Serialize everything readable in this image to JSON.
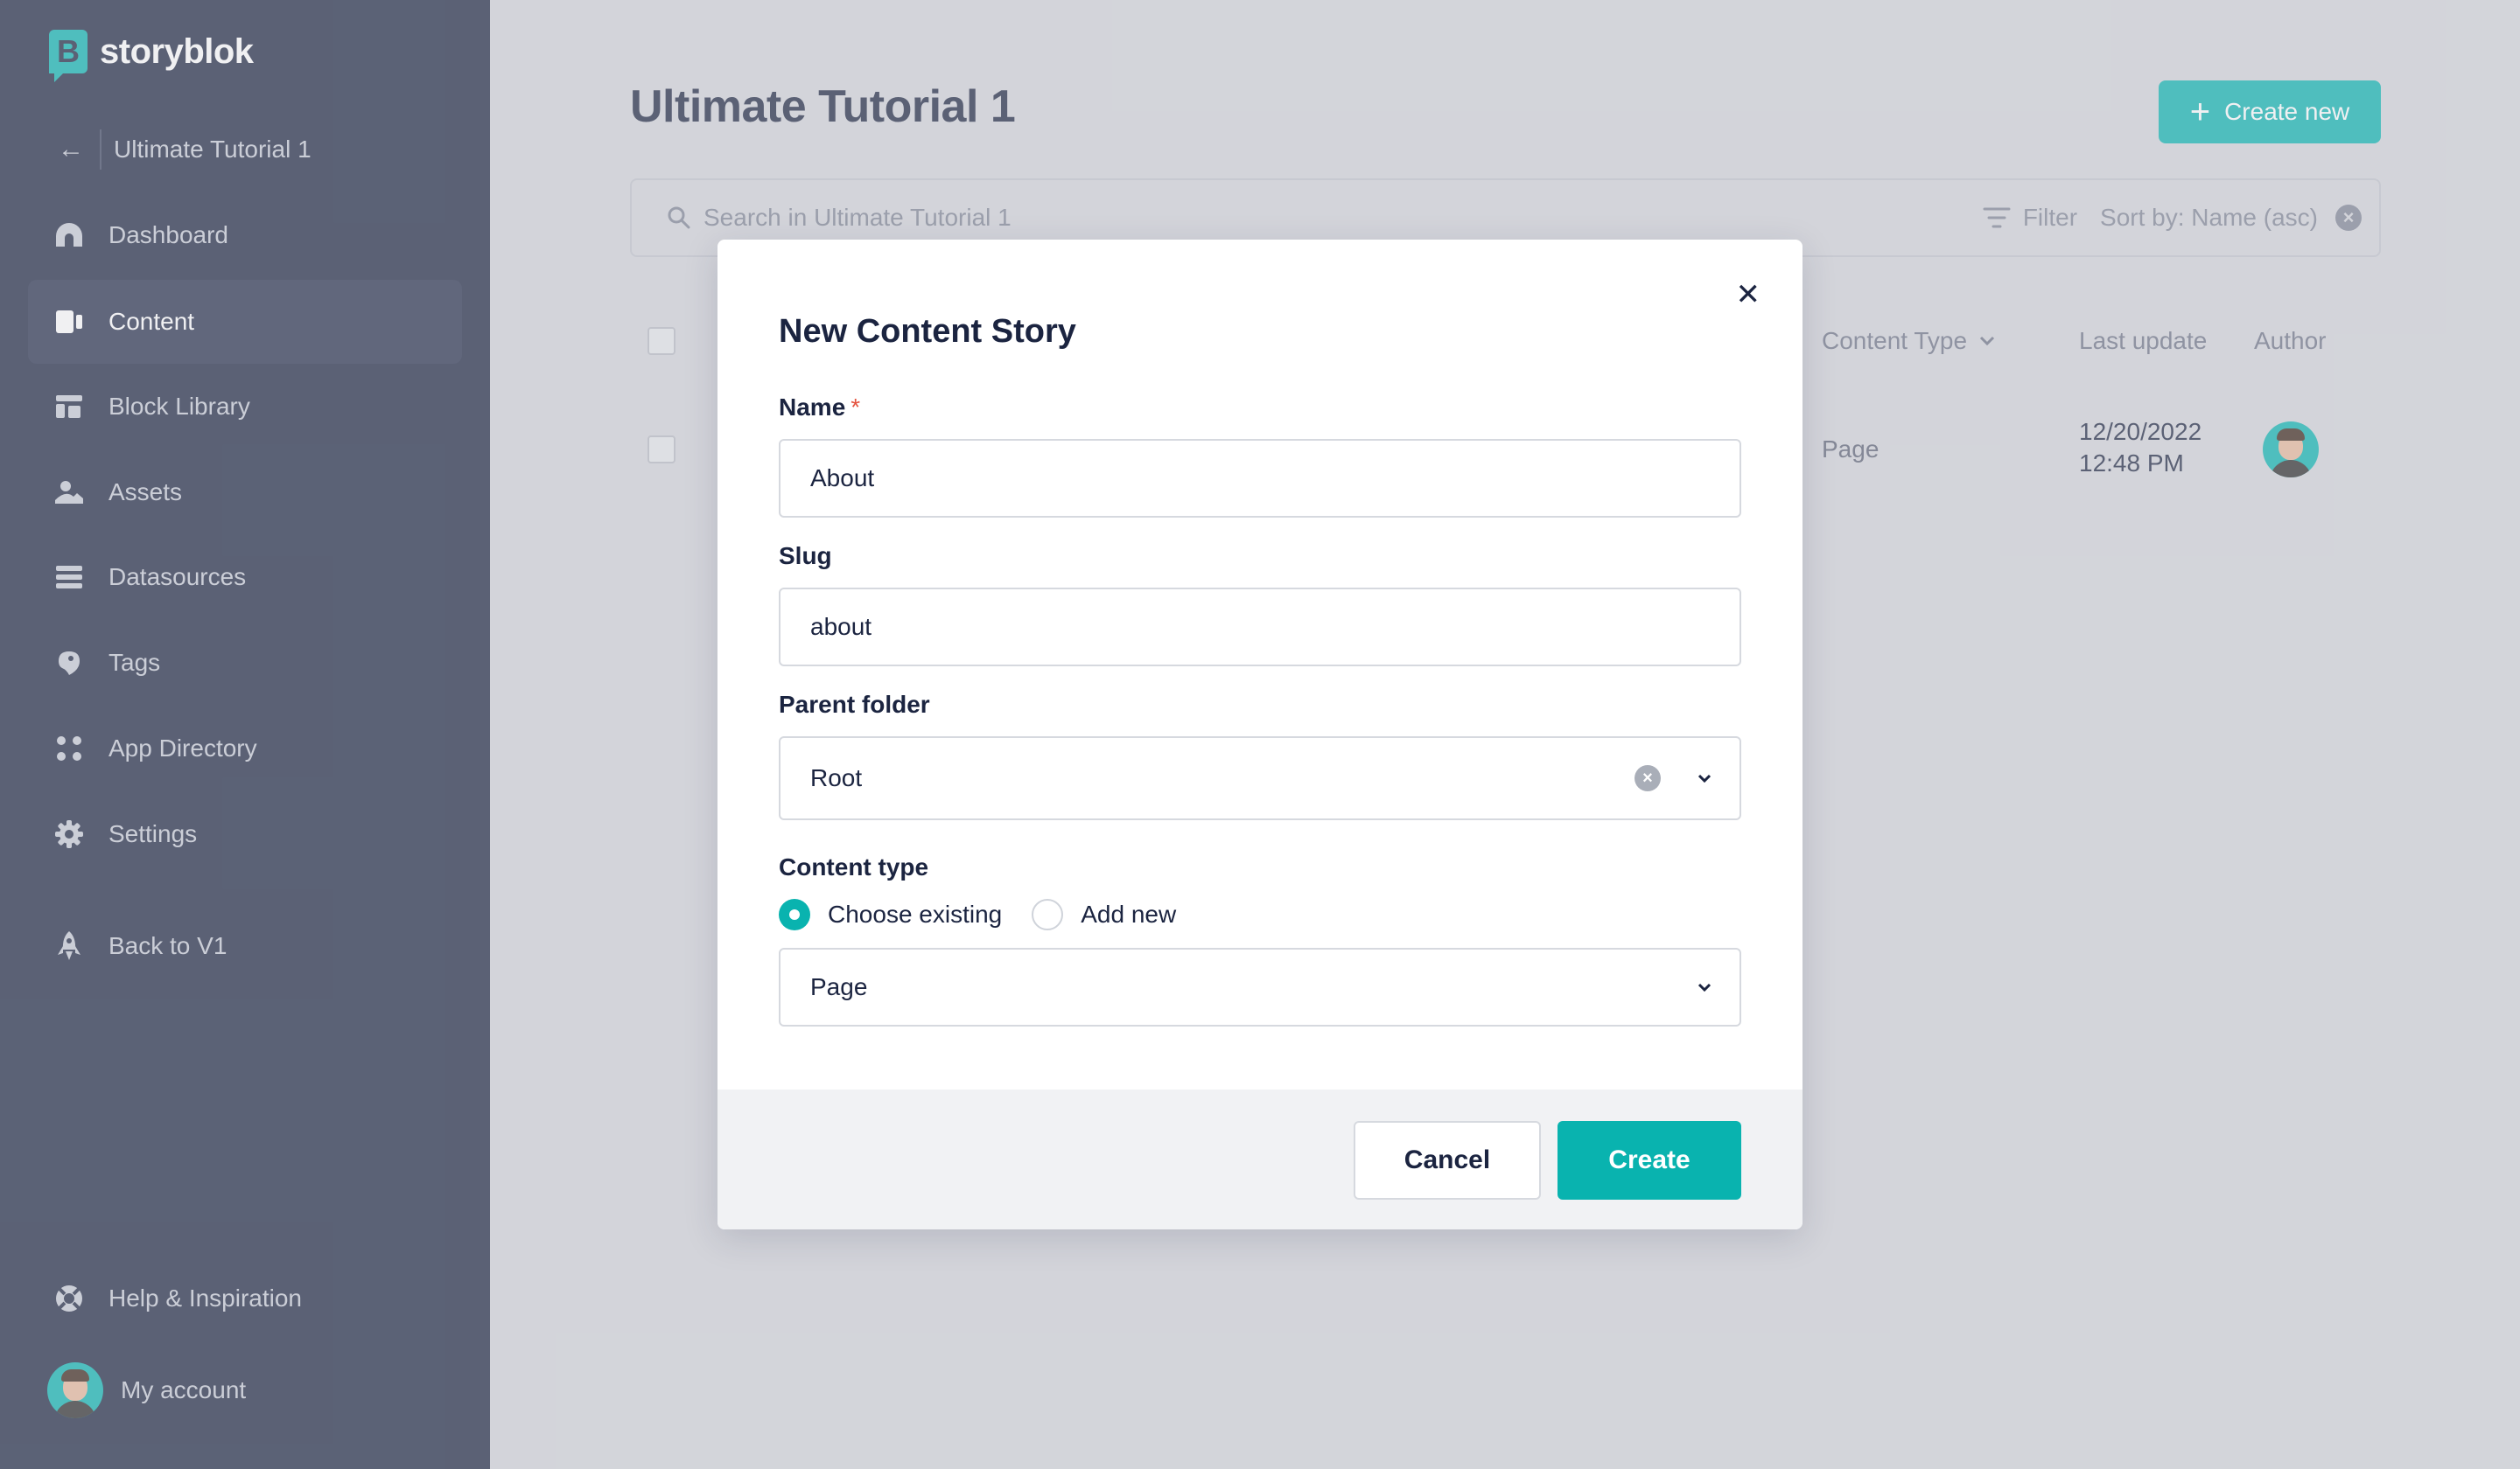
{
  "brand": {
    "name": "storyblok",
    "logo_letter": "B"
  },
  "sidebar": {
    "space_name": "Ultimate Tutorial 1",
    "items": [
      {
        "label": "Dashboard",
        "icon": "dashboard-icon"
      },
      {
        "label": "Content",
        "icon": "content-icon",
        "active": true
      },
      {
        "label": "Block Library",
        "icon": "block-library-icon"
      },
      {
        "label": "Assets",
        "icon": "assets-icon"
      },
      {
        "label": "Datasources",
        "icon": "datasources-icon"
      },
      {
        "label": "Tags",
        "icon": "tag-icon"
      },
      {
        "label": "App Directory",
        "icon": "app-directory-icon"
      },
      {
        "label": "Settings",
        "icon": "gear-icon"
      },
      {
        "label": "Back to V1",
        "icon": "rocket-icon"
      }
    ],
    "help_label": "Help & Inspiration",
    "account_label": "My account"
  },
  "main": {
    "title": "Ultimate Tutorial 1",
    "create_new_label": "Create new",
    "search": {
      "placeholder": "Search in Ultimate Tutorial 1"
    },
    "filter_label": "Filter",
    "sort_label": "Sort by: Name (asc)",
    "columns": {
      "content_type": "Content Type",
      "last_update": "Last update",
      "author": "Author"
    },
    "rows": [
      {
        "content_type": "Page",
        "date": "12/20/2022",
        "time": "12:48 PM"
      }
    ]
  },
  "modal": {
    "title": "New Content Story",
    "name_label": "Name",
    "required_mark": "*",
    "name_value": "About",
    "slug_label": "Slug",
    "slug_value": "about",
    "parent_folder_label": "Parent folder",
    "parent_folder_value": "Root",
    "content_type_label": "Content type",
    "radio_existing": "Choose existing",
    "radio_new": "Add new",
    "content_type_value": "Page",
    "cancel_label": "Cancel",
    "create_label": "Create"
  },
  "colors": {
    "accent": "#09b3af",
    "sidebar_bg": "#1b2440",
    "page_bg": "#d3d5da",
    "required": "#e4533f"
  }
}
